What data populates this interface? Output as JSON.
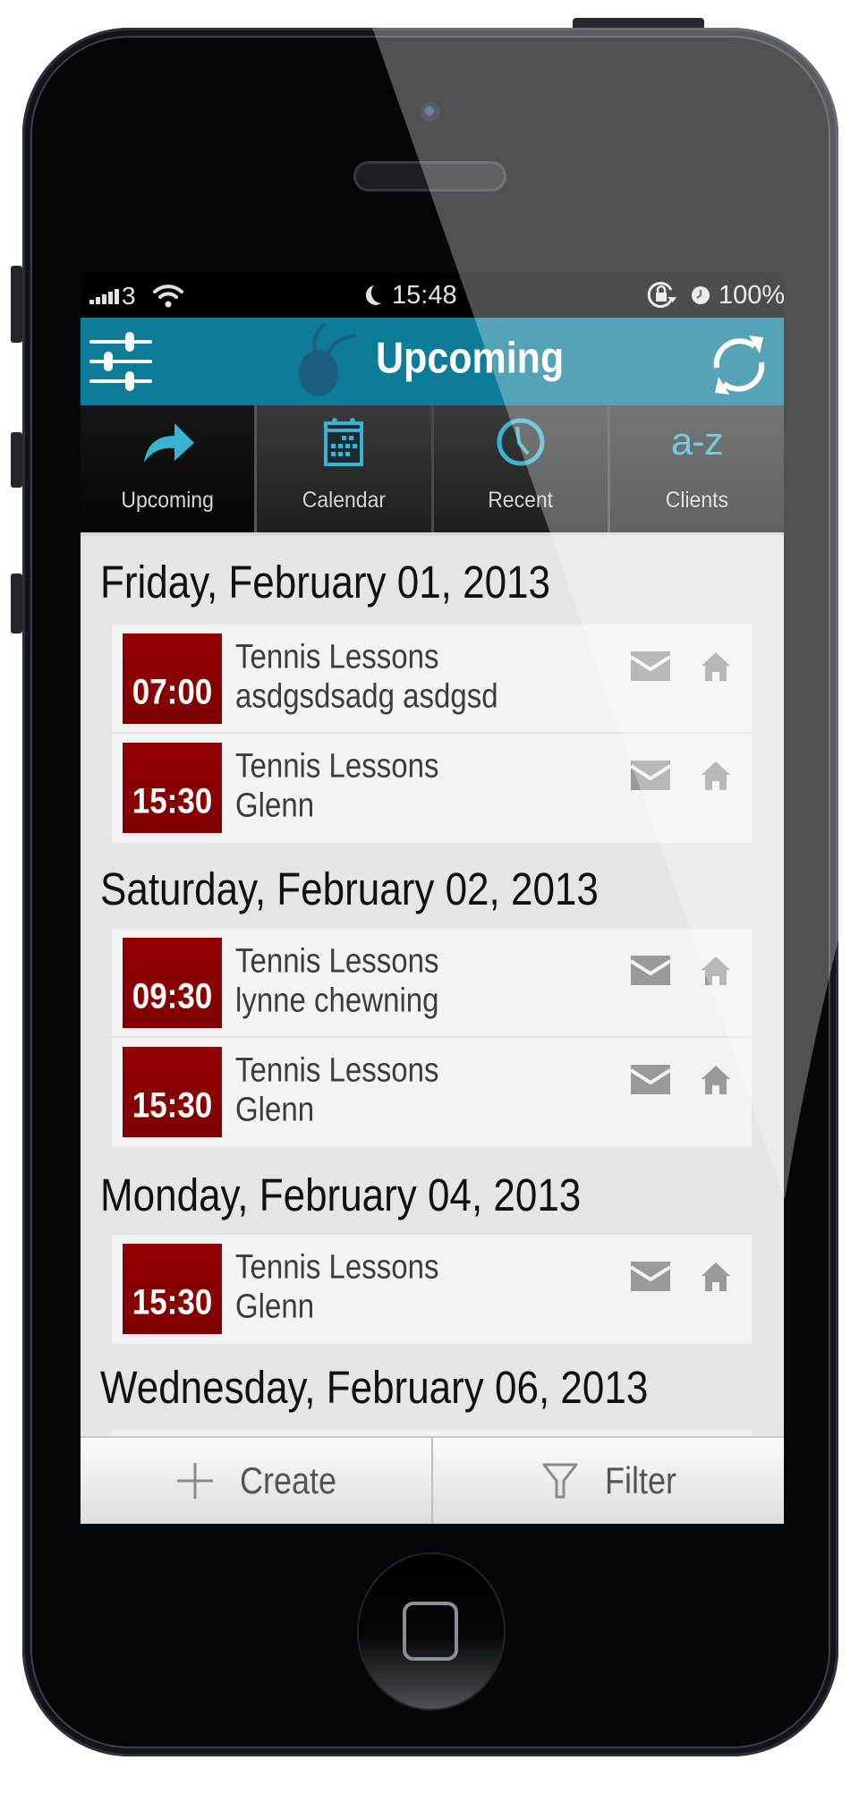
{
  "status_bar": {
    "carrier": "3",
    "time": "15:48",
    "battery_percent": "100%",
    "icons": [
      "signal-icon",
      "wifi-icon",
      "do-not-disturb-moon-icon",
      "rotation-lock-icon",
      "alarm-icon",
      "battery-charging-icon"
    ]
  },
  "header": {
    "title": "Upcoming",
    "left_icon": "sliders-settings-icon",
    "logo": "app-logo-icon",
    "right_icon": "refresh-icon"
  },
  "tabs": [
    {
      "label": "Upcoming",
      "icon": "forward-arrow-icon",
      "active": true
    },
    {
      "label": "Calendar",
      "icon": "calendar-icon",
      "active": false
    },
    {
      "label": "Recent",
      "icon": "clock-icon",
      "active": false
    },
    {
      "label": "Clients",
      "icon_text": "a-z",
      "icon": "alphabetical-icon",
      "active": false
    }
  ],
  "colors": {
    "header": "#0d7c98",
    "accent": "#38b4d2",
    "time_box": "#8b0000"
  },
  "days": [
    {
      "date": "Friday, February 01, 2013",
      "appointments": [
        {
          "time": "07:00",
          "title": "Tennis Lessons",
          "client": "asdgsdsadg asdgsd"
        },
        {
          "time": "15:30",
          "title": "Tennis Lessons",
          "client": "Glenn"
        }
      ]
    },
    {
      "date": "Saturday, February 02, 2013",
      "appointments": [
        {
          "time": "09:30",
          "title": "Tennis Lessons",
          "client": "lynne chewning"
        },
        {
          "time": "15:30",
          "title": "Tennis Lessons",
          "client": "Glenn"
        }
      ]
    },
    {
      "date": "Monday, February 04, 2013",
      "appointments": [
        {
          "time": "15:30",
          "title": "Tennis Lessons",
          "client": "Glenn"
        }
      ]
    },
    {
      "date": "Wednesday, February 06, 2013",
      "appointments": []
    }
  ],
  "toolbar": {
    "create_label": "Create",
    "filter_label": "Filter"
  }
}
